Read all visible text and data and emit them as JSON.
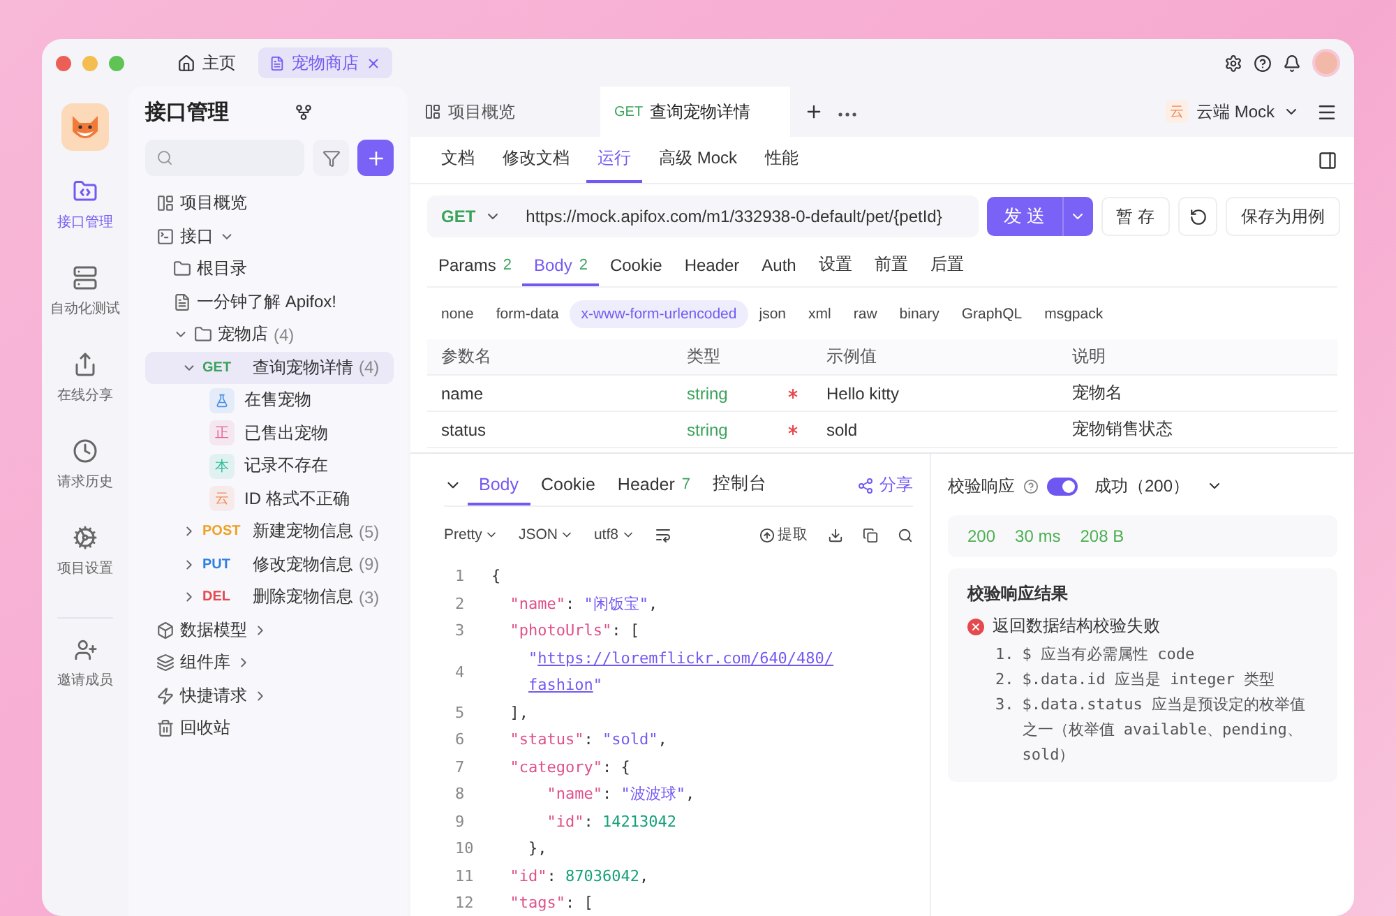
{
  "window": {
    "tabs": [
      {
        "kind": "home",
        "label": "主页",
        "selected": false
      },
      {
        "kind": "project",
        "label": "宠物商店",
        "selected": true
      }
    ]
  },
  "rail": {
    "items": [
      {
        "kind": "api",
        "label": "接口管理",
        "selected": true
      },
      {
        "kind": "test",
        "label": "自动化测试",
        "selected": false
      },
      {
        "kind": "share",
        "label": "在线分享",
        "selected": false
      },
      {
        "kind": "history",
        "label": "请求历史",
        "selected": false
      },
      {
        "kind": "settings",
        "label": "项目设置",
        "selected": false
      }
    ],
    "invite": "邀请成员"
  },
  "sidebar": {
    "title": "接口管理",
    "tree": [
      {
        "kind": "overview",
        "label": "项目概览"
      },
      {
        "kind": "api",
        "label": "接口",
        "expanded": true,
        "children": [
          {
            "kind": "folder",
            "label": "根目录"
          },
          {
            "kind": "markdown",
            "label": "一分钟了解 Apifox!"
          },
          {
            "kind": "folder",
            "label": "宠物店",
            "count": "(4)",
            "expanded": true,
            "children": [
              {
                "kind": "endpoint",
                "method": "GET",
                "color": "#3aa35a",
                "label": "查询宠物详情",
                "count": "(4)",
                "expanded": true,
                "selected": true,
                "children": [
                  {
                    "kind": "case",
                    "color": "#4a90e2",
                    "label": "在售宠物"
                  },
                  {
                    "kind": "case",
                    "badge": "正",
                    "color": "#e8618c",
                    "label": "已售出宠物"
                  },
                  {
                    "kind": "case",
                    "badge": "本",
                    "color": "#2fbf9a",
                    "label": "记录不存在"
                  },
                  {
                    "kind": "case",
                    "badge": "云",
                    "color": "#f08c5a",
                    "label": "ID 格式不正确"
                  }
                ]
              },
              {
                "kind": "endpoint",
                "method": "POST",
                "color": "#eea01e",
                "label": "新建宠物信息",
                "count": "(5)",
                "expanded": false,
                "selected": false
              },
              {
                "kind": "endpoint",
                "method": "PUT",
                "color": "#2f7fe0",
                "label": "修改宠物信息",
                "count": "(9)",
                "expanded": false,
                "selected": false
              },
              {
                "kind": "endpoint",
                "method": "DEL",
                "color": "#e5484d",
                "label": "删除宠物信息",
                "count": "(3)",
                "expanded": false,
                "selected": false
              }
            ]
          }
        ]
      },
      {
        "kind": "models",
        "label": "数据模型",
        "expanded": false
      },
      {
        "kind": "components",
        "label": "组件库",
        "expanded": false
      },
      {
        "kind": "quick",
        "label": "快捷请求",
        "expanded": false
      },
      {
        "kind": "trash",
        "label": "回收站"
      }
    ]
  },
  "tabs": [
    {
      "kind": "overview",
      "label": "项目概览",
      "selected": false
    },
    {
      "kind": "endpoint",
      "method": "GET",
      "label": "查询宠物详情",
      "selected": true
    }
  ],
  "environment": {
    "badge": "云",
    "label": "云端 Mock"
  },
  "subtabs": [
    {
      "label": "文档",
      "selected": false
    },
    {
      "label": "修改文档",
      "selected": false
    },
    {
      "label": "运行",
      "selected": true
    },
    {
      "label": "高级 Mock",
      "selected": false
    },
    {
      "label": "性能",
      "selected": false
    }
  ],
  "request": {
    "method": "GET",
    "url": "https://mock.apifox.com/m1/332938-0-default/pet/{petId}",
    "send": "发 送",
    "save": "暂 存",
    "save_case": "保存为用例"
  },
  "param_tabs": [
    {
      "label": "Params",
      "count": "2",
      "selected": false
    },
    {
      "label": "Body",
      "count": "2",
      "selected": true
    },
    {
      "label": "Cookie",
      "selected": false
    },
    {
      "label": "Header",
      "selected": false
    },
    {
      "label": "Auth",
      "selected": false
    },
    {
      "label": "设置",
      "selected": false
    },
    {
      "label": "前置",
      "selected": false
    },
    {
      "label": "后置",
      "selected": false
    }
  ],
  "body_types": [
    {
      "label": "none",
      "selected": false
    },
    {
      "label": "form-data",
      "selected": false
    },
    {
      "label": "x-www-form-urlencoded",
      "selected": true
    },
    {
      "label": "json",
      "selected": false
    },
    {
      "label": "xml",
      "selected": false
    },
    {
      "label": "raw",
      "selected": false
    },
    {
      "label": "binary",
      "selected": false
    },
    {
      "label": "GraphQL",
      "selected": false
    },
    {
      "label": "msgpack",
      "selected": false
    }
  ],
  "table": {
    "columns": [
      "参数名",
      "类型",
      "示例值",
      "说明"
    ],
    "rows": [
      {
        "name": "name",
        "type": "string",
        "required": true,
        "example": "Hello kitty",
        "description": "宠物名"
      },
      {
        "name": "status",
        "type": "string",
        "required": true,
        "example": "sold",
        "description": "宠物销售状态"
      }
    ]
  },
  "response": {
    "tabs": [
      {
        "label": "Body",
        "selected": true
      },
      {
        "label": "Cookie",
        "selected": false
      },
      {
        "label": "Header",
        "count": "7",
        "selected": false
      },
      {
        "label": "控制台",
        "selected": false
      }
    ],
    "share": "分享",
    "formats": [
      "Pretty",
      "JSON",
      "utf8"
    ],
    "extract": "提取",
    "code": [
      {
        "number": "1",
        "rows": [
          [
            {
              "kind": "punct",
              "text": "{"
            }
          ]
        ]
      },
      {
        "number": "2",
        "rows": [
          [
            {
              "kind": "key",
              "text": "  \"name\""
            },
            {
              "kind": "punct",
              "text": ": "
            },
            {
              "kind": "string",
              "text": "\"闲饭宝\""
            },
            {
              "kind": "punct",
              "text": ","
            }
          ]
        ]
      },
      {
        "number": "3",
        "rows": [
          [
            {
              "kind": "key",
              "text": "  \"photoUrls\""
            },
            {
              "kind": "punct",
              "text": ": ["
            }
          ]
        ]
      },
      {
        "number": "4",
        "rows": [
          [
            {
              "kind": "string",
              "text": "    \""
            },
            {
              "kind": "link",
              "text": "https://loremflickr.com/640/480/"
            }
          ],
          [
            {
              "kind": "link",
              "text": "fashion"
            },
            {
              "kind": "string",
              "text": "\""
            }
          ]
        ]
      },
      {
        "number": "5",
        "rows": [
          [
            {
              "kind": "punct",
              "text": "  ],"
            }
          ]
        ]
      },
      {
        "number": "6",
        "rows": [
          [
            {
              "kind": "key",
              "text": "  \"status\""
            },
            {
              "kind": "punct",
              "text": ": "
            },
            {
              "kind": "string",
              "text": "\"sold\""
            },
            {
              "kind": "punct",
              "text": ","
            }
          ]
        ]
      },
      {
        "number": "7",
        "rows": [
          [
            {
              "kind": "key",
              "text": "  \"category\""
            },
            {
              "kind": "punct",
              "text": ": {"
            }
          ]
        ]
      },
      {
        "number": "8",
        "rows": [
          [
            {
              "kind": "key",
              "text": "      \"name\""
            },
            {
              "kind": "punct",
              "text": ": "
            },
            {
              "kind": "string",
              "text": "\"波波球\""
            },
            {
              "kind": "punct",
              "text": ","
            }
          ]
        ]
      },
      {
        "number": "9",
        "rows": [
          [
            {
              "kind": "key",
              "text": "      \"id\""
            },
            {
              "kind": "punct",
              "text": ": "
            },
            {
              "kind": "number",
              "text": "14213042"
            }
          ]
        ]
      },
      {
        "number": "10",
        "rows": [
          [
            {
              "kind": "punct",
              "text": "    },"
            }
          ]
        ]
      },
      {
        "number": "11",
        "rows": [
          [
            {
              "kind": "key",
              "text": "  \"id\""
            },
            {
              "kind": "punct",
              "text": ": "
            },
            {
              "kind": "number",
              "text": "87036042"
            },
            {
              "kind": "punct",
              "text": ","
            }
          ]
        ]
      },
      {
        "number": "12",
        "rows": [
          [
            {
              "kind": "key",
              "text": "  \"tags\""
            },
            {
              "kind": "punct",
              "text": ": ["
            }
          ]
        ]
      }
    ]
  },
  "validation": {
    "label": "校验响应",
    "on": true,
    "status": "成功（200）",
    "stats": [
      "200",
      "30 ms",
      "208 B"
    ],
    "result_title": "校验响应结果",
    "error": "返回数据结构校验失败",
    "messages": [
      {
        "number": "1.",
        "text": "$ 应当有必需属性 code"
      },
      {
        "number": "2.",
        "text": "$.data.id 应当是 integer 类型"
      },
      {
        "number": "3.",
        "text": "$.data.status 应当是预设定的枚举值之一（枚举值 available、pending、sold）"
      }
    ]
  }
}
